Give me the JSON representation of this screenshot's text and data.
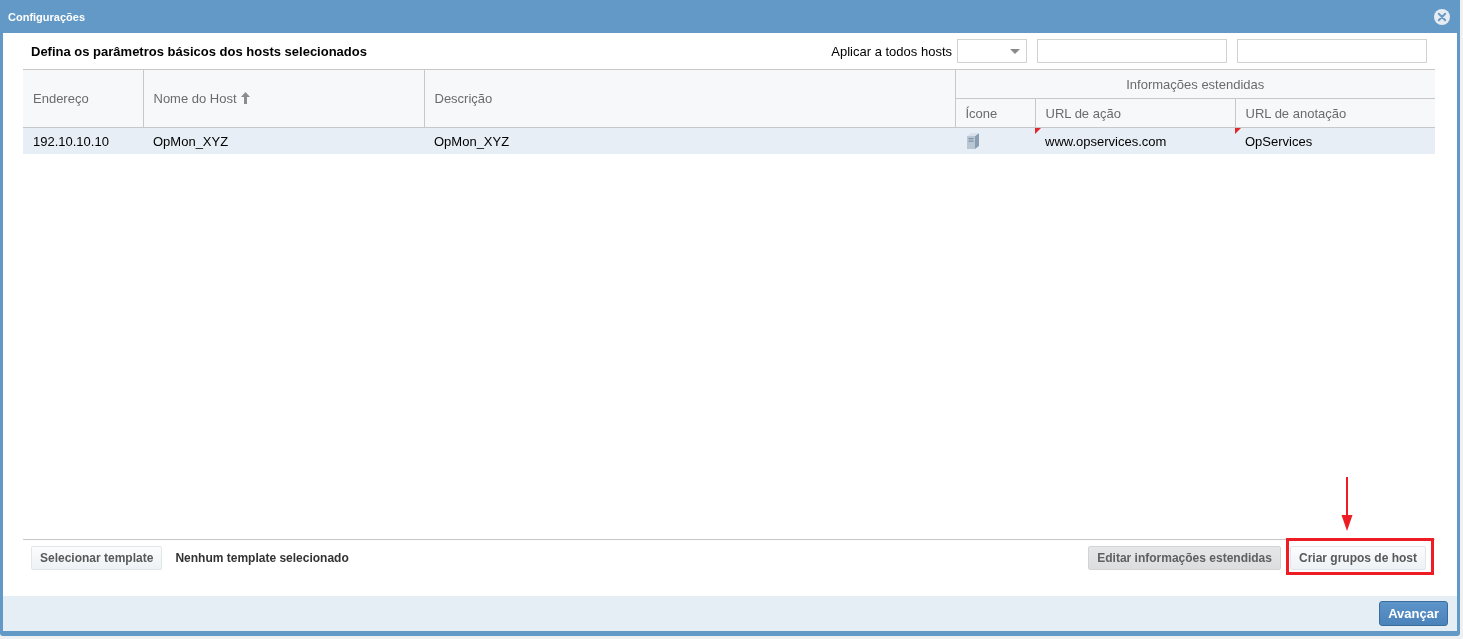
{
  "window": {
    "title": "Configurações"
  },
  "top_bar": {
    "heading": "Defina os parâmetros básicos dos hosts selecionados",
    "apply_label": "Aplicar a todos hosts",
    "apply_fields": [
      {
        "kind": "select"
      },
      {
        "kind": "text"
      },
      {
        "kind": "text"
      }
    ]
  },
  "table": {
    "columns": [
      {
        "label": "Endereço",
        "sorted": false
      },
      {
        "label": "Nome do Host",
        "sorted": true
      },
      {
        "label": "Descrição",
        "sorted": false
      },
      {
        "label": "Informações estendidas",
        "colspan": 3,
        "children": [
          {
            "label": "Ícone",
            "sorted": false
          },
          {
            "label": "URL de ação",
            "sorted": false
          },
          {
            "label": "URL de anotação",
            "sorted": false
          }
        ]
      }
    ],
    "rows": [
      {
        "selected": true,
        "cells": [
          {
            "kind": "text",
            "text": "192.10.10.10",
            "modified": false
          },
          {
            "kind": "text",
            "text": "OpMon_XYZ",
            "modified": false
          },
          {
            "kind": "text",
            "text": "OpMon_XYZ",
            "modified": false
          },
          {
            "kind": "icon",
            "modified": false
          },
          {
            "kind": "text",
            "text": "www.opservices.com",
            "modified": true
          },
          {
            "kind": "text",
            "text": "OpServices",
            "modified": true
          }
        ]
      }
    ]
  },
  "bottom_bar": {
    "left_buttons": [
      {
        "label": "Selecionar template",
        "disabled": false,
        "highlighted": false
      }
    ],
    "status": "Nenhum template selecionado",
    "right_buttons": [
      {
        "label": "Editar informações estendidas",
        "disabled": true,
        "highlighted": false
      },
      {
        "label": "Criar grupos de host",
        "disabled": false,
        "highlighted": true
      }
    ]
  },
  "footer": {
    "buttons": [
      {
        "label": "Avançar",
        "kind": "primary"
      }
    ]
  }
}
